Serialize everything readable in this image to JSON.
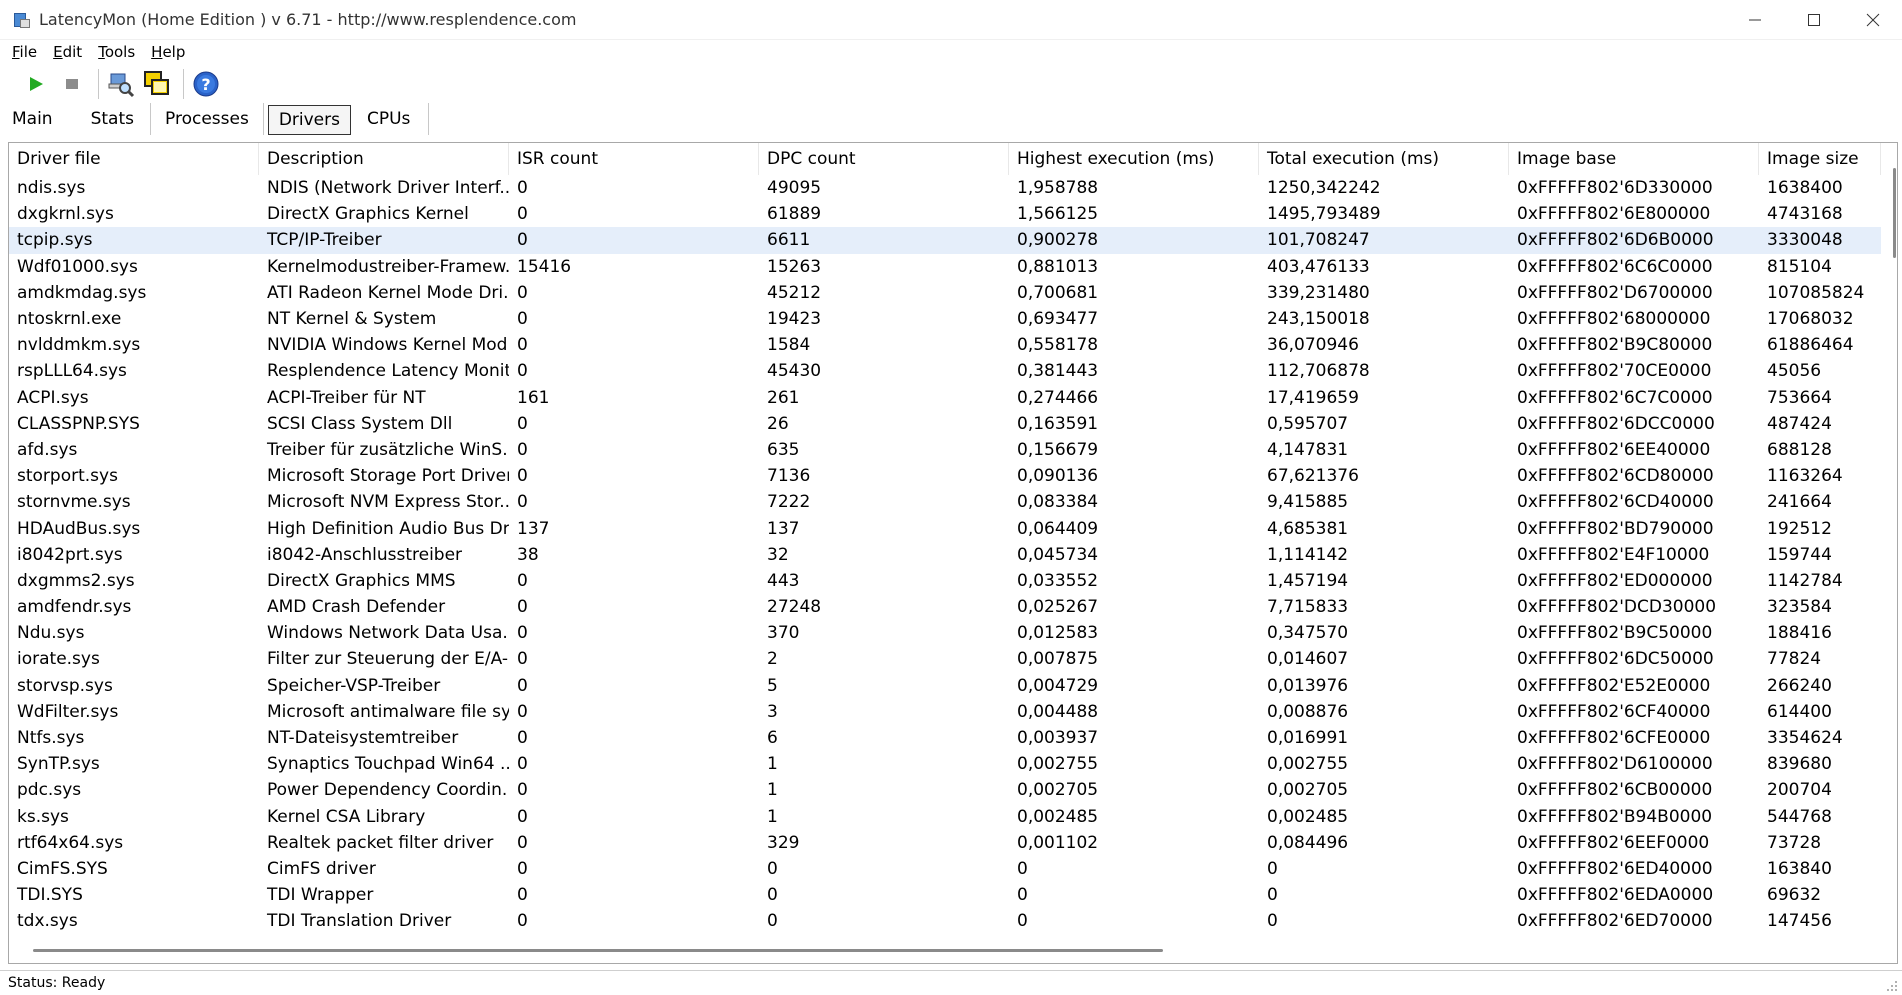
{
  "window": {
    "title": "LatencyMon  (Home Edition )  v 6.71 - http://www.resplendence.com"
  },
  "menu": [
    {
      "label": "File",
      "accel": "F",
      "rest": "ile"
    },
    {
      "label": "Edit",
      "accel": "E",
      "rest": "dit"
    },
    {
      "label": "Tools",
      "accel": "T",
      "rest": "ools"
    },
    {
      "label": "Help",
      "accel": "H",
      "rest": "elp"
    }
  ],
  "toolbar": {
    "icons": [
      "play-icon",
      "stop-icon",
      "search-driver-icon",
      "copy-windows-icon",
      "help-icon"
    ],
    "colors": {
      "play": "#22aa22",
      "stop": "#8c8c8c",
      "help": "#2a62c8"
    }
  },
  "tabs": [
    "Main",
    "Stats",
    "Processes",
    "Drivers",
    "CPUs"
  ],
  "active_tab": "Drivers",
  "table": {
    "columns": [
      "Driver file",
      "Description",
      "ISR count",
      "DPC count",
      "Highest execution (ms)",
      "Total execution (ms)",
      "Image base",
      "Image size"
    ],
    "selected_row": 2,
    "rows": [
      [
        "ndis.sys",
        "NDIS (Network Driver Interf...",
        "0",
        "49095",
        "1,958788",
        "1250,342242",
        "0xFFFFF802'6D330000",
        "1638400"
      ],
      [
        "dxgkrnl.sys",
        "DirectX Graphics Kernel",
        "0",
        "61889",
        "1,566125",
        "1495,793489",
        "0xFFFFF802'6E800000",
        "4743168"
      ],
      [
        "tcpip.sys",
        "TCP/IP-Treiber",
        "0",
        "6611",
        "0,900278",
        "101,708247",
        "0xFFFFF802'6D6B0000",
        "3330048"
      ],
      [
        "Wdf01000.sys",
        "Kernelmodustreiber-Framew...",
        "15416",
        "15263",
        "0,881013",
        "403,476133",
        "0xFFFFF802'6C6C0000",
        "815104"
      ],
      [
        "amdkmdag.sys",
        "ATI Radeon Kernel Mode Dri...",
        "0",
        "45212",
        "0,700681",
        "339,231480",
        "0xFFFFF802'D6700000",
        "107085824"
      ],
      [
        "ntoskrnl.exe",
        "NT Kernel & System",
        "0",
        "19423",
        "0,693477",
        "243,150018",
        "0xFFFFF802'68000000",
        "17068032"
      ],
      [
        "nvlddmkm.sys",
        "NVIDIA Windows Kernel Mod...",
        "0",
        "1584",
        "0,558178",
        "36,070946",
        "0xFFFFF802'B9C80000",
        "61886464"
      ],
      [
        "rspLLL64.sys",
        "Resplendence Latency Monit...",
        "0",
        "45430",
        "0,381443",
        "112,706878",
        "0xFFFFF802'70CE0000",
        "45056"
      ],
      [
        "ACPI.sys",
        "ACPI-Treiber für NT",
        "161",
        "261",
        "0,274466",
        "17,419659",
        "0xFFFFF802'6C7C0000",
        "753664"
      ],
      [
        "CLASSPNP.SYS",
        "SCSI Class System Dll",
        "0",
        "26",
        "0,163591",
        "0,595707",
        "0xFFFFF802'6DCC0000",
        "487424"
      ],
      [
        "afd.sys",
        "Treiber für zusätzliche WinS...",
        "0",
        "635",
        "0,156679",
        "4,147831",
        "0xFFFFF802'6EE40000",
        "688128"
      ],
      [
        "storport.sys",
        "Microsoft Storage Port Driver",
        "0",
        "7136",
        "0,090136",
        "67,621376",
        "0xFFFFF802'6CD80000",
        "1163264"
      ],
      [
        "stornvme.sys",
        "Microsoft NVM Express Stor...",
        "0",
        "7222",
        "0,083384",
        "9,415885",
        "0xFFFFF802'6CD40000",
        "241664"
      ],
      [
        "HDAudBus.sys",
        "High Definition Audio Bus Dri...",
        "137",
        "137",
        "0,064409",
        "4,685381",
        "0xFFFFF802'BD790000",
        "192512"
      ],
      [
        "i8042prt.sys",
        "i8042-Anschlusstreiber",
        "38",
        "32",
        "0,045734",
        "1,114142",
        "0xFFFFF802'E4F10000",
        "159744"
      ],
      [
        "dxgmms2.sys",
        "DirectX Graphics MMS",
        "0",
        "443",
        "0,033552",
        "1,457194",
        "0xFFFFF802'ED000000",
        "1142784"
      ],
      [
        "amdfendr.sys",
        "AMD Crash Defender",
        "0",
        "27248",
        "0,025267",
        "7,715833",
        "0xFFFFF802'DCD30000",
        "323584"
      ],
      [
        "Ndu.sys",
        "Windows Network Data Usa...",
        "0",
        "370",
        "0,012583",
        "0,347570",
        "0xFFFFF802'B9C50000",
        "188416"
      ],
      [
        "iorate.sys",
        "Filter zur Steuerung der E/A-...",
        "0",
        "2",
        "0,007875",
        "0,014607",
        "0xFFFFF802'6DC50000",
        "77824"
      ],
      [
        "storvsp.sys",
        "Speicher-VSP-Treiber",
        "0",
        "5",
        "0,004729",
        "0,013976",
        "0xFFFFF802'E52E0000",
        "266240"
      ],
      [
        "WdFilter.sys",
        "Microsoft antimalware file sys...",
        "0",
        "3",
        "0,004488",
        "0,008876",
        "0xFFFFF802'6CF40000",
        "614400"
      ],
      [
        "Ntfs.sys",
        "NT-Dateisystemtreiber",
        "0",
        "6",
        "0,003937",
        "0,016991",
        "0xFFFFF802'6CFE0000",
        "3354624"
      ],
      [
        "SynTP.sys",
        "Synaptics Touchpad Win64 ...",
        "0",
        "1",
        "0,002755",
        "0,002755",
        "0xFFFFF802'D6100000",
        "839680"
      ],
      [
        "pdc.sys",
        "Power Dependency Coordin...",
        "0",
        "1",
        "0,002705",
        "0,002705",
        "0xFFFFF802'6CB00000",
        "200704"
      ],
      [
        "ks.sys",
        "Kernel CSA Library",
        "0",
        "1",
        "0,002485",
        "0,002485",
        "0xFFFFF802'B94B0000",
        "544768"
      ],
      [
        "rtf64x64.sys",
        "Realtek packet filter driver",
        "0",
        "329",
        "0,001102",
        "0,084496",
        "0xFFFFF802'6EEF0000",
        "73728"
      ],
      [
        "CimFS.SYS",
        "CimFS driver",
        "0",
        "0",
        "0",
        "0",
        "0xFFFFF802'6ED40000",
        "163840"
      ],
      [
        "TDI.SYS",
        "TDI Wrapper",
        "0",
        "0",
        "0",
        "0",
        "0xFFFFF802'6EDA0000",
        "69632"
      ],
      [
        "tdx.sys",
        "TDI Translation Driver",
        "0",
        "0",
        "0",
        "0",
        "0xFFFFF802'6ED70000",
        "147456"
      ]
    ]
  },
  "status": "Status: Ready"
}
